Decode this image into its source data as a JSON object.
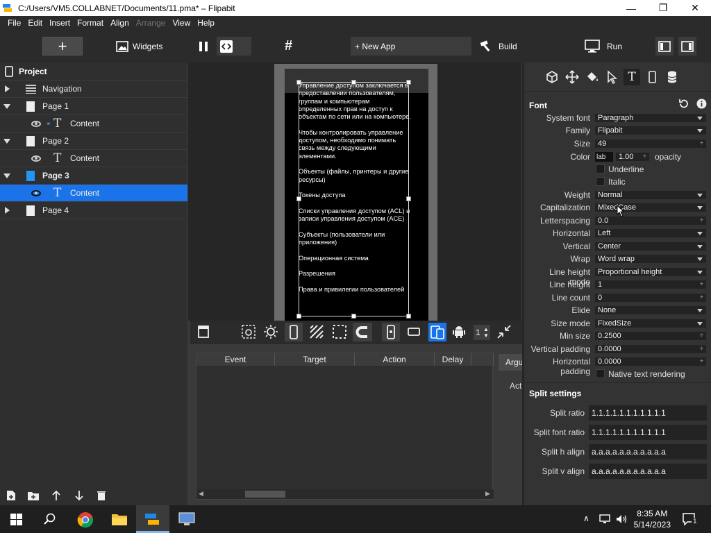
{
  "titlebar": {
    "title": "C:/Users/VM5.COLLABNET/Documents/11.pma* – Flipabit",
    "minimize": "—",
    "maximize": "❐",
    "close": "✕"
  },
  "menu": [
    "File",
    "Edit",
    "Insert",
    "Format",
    "Align",
    "Arrange",
    "View",
    "Help"
  ],
  "toolbar": {
    "add": "+",
    "widgets": "Widgets",
    "new_app": "+ New App",
    "build": "Build",
    "run": "Run"
  },
  "tree": {
    "header": "Project",
    "items": [
      {
        "label": "Navigation"
      },
      {
        "label": "Page 1"
      },
      {
        "label": "Content"
      },
      {
        "label": "Page 2"
      },
      {
        "label": "Content"
      },
      {
        "label": "Page 3"
      },
      {
        "label": "Content"
      },
      {
        "label": "Page 4"
      }
    ]
  },
  "canvas": {
    "content_text": "Управление доступом заключается в предоставлении пользователям, группам и компьютерам определенных прав на доступ к объектам по сети или на компьютере.\n\nЧтобы контролировать управление доступом, необходимо понимать связь между следующими элементами.\n\nОбъекты (файлы, принтеры и другие ресурсы)\n\nТокены доступа\n\nСписки управления доступом (ACL) и записи управления доступом (ACE)\n\nСубъекты (пользователи или приложения)\n\nОперационная система\n\nРазрешения\n\nПрава и привилегии пользователей"
  },
  "device_bar": {
    "scale_value": "1"
  },
  "events": {
    "columns": [
      "Event",
      "Target",
      "Action",
      "Delay"
    ],
    "tab": "Argu",
    "act_label": "Act"
  },
  "font_panel": {
    "title": "Font",
    "system_font": {
      "label": "System font",
      "value": "Paragraph"
    },
    "family": {
      "label": "Family",
      "value": "Flipabit"
    },
    "size": {
      "label": "Size",
      "value": "49"
    },
    "color": {
      "label": "Color",
      "swatch": "lab",
      "opacity_value": "1.00",
      "opacity_label": "opacity"
    },
    "underline": "Underline",
    "italic": "Italic",
    "weight": {
      "label": "Weight",
      "value": "Normal"
    },
    "capitalization": {
      "label": "Capitalization",
      "value": "MixedCase"
    },
    "letterspacing": {
      "label": "Letterspacing",
      "value": "0.0"
    },
    "horizontal": {
      "label": "Horizontal",
      "value": "Left"
    },
    "vertical": {
      "label": "Vertical",
      "value": "Center"
    },
    "wrap": {
      "label": "Wrap",
      "value": "Word wrap"
    },
    "line_height_mode": {
      "label": "Line height mode",
      "value": "Proportional height"
    },
    "line_height": {
      "label": "Line height",
      "value": "1"
    },
    "line_count": {
      "label": "Line count",
      "value": "0"
    },
    "elide": {
      "label": "Elide",
      "value": "None"
    },
    "size_mode": {
      "label": "Size mode",
      "value": "FixedSize"
    },
    "min_size": {
      "label": "Min size",
      "value": "0.2500"
    },
    "vertical_padding": {
      "label": "Vertical padding",
      "value": "0.0000"
    },
    "horizontal_padding": {
      "label": "Horizontal padding",
      "value": "0.0000"
    },
    "native_text": "Native text rendering"
  },
  "split_panel": {
    "title": "Split settings",
    "ratio": {
      "label": "Split ratio",
      "value": "1.1.1.1.1.1.1.1.1.1.1"
    },
    "font_ratio": {
      "label": "Split font ratio",
      "value": "1.1.1.1.1.1.1.1.1.1.1"
    },
    "h_align": {
      "label": "Split h align",
      "value": "a.a.a.a.a.a.a.a.a.a.a"
    },
    "v_align": {
      "label": "Split v align",
      "value": "a.a.a.a.a.a.a.a.a.a.a"
    }
  },
  "taskbar": {
    "time": "8:35 AM",
    "date": "5/14/2023",
    "notification_count": "1"
  },
  "colors": {
    "accent": "#1a73e8",
    "panel": "#2f2f2f",
    "canvas": "#262626"
  }
}
